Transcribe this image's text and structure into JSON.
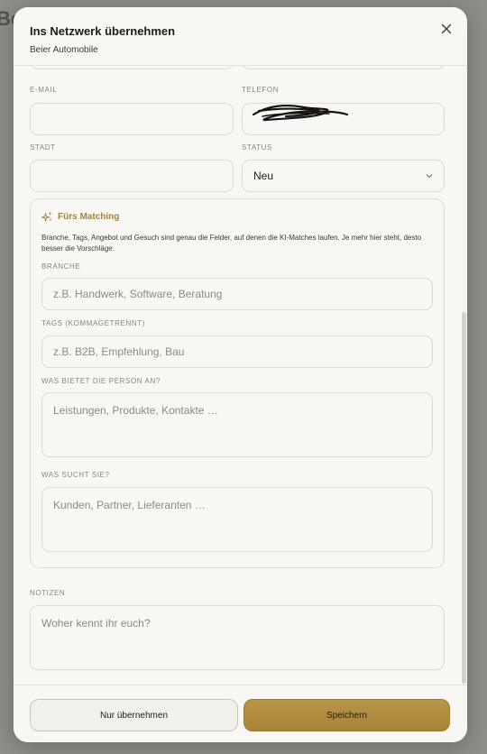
{
  "backdrop": {
    "peek_text": "Be"
  },
  "modal": {
    "title": "Ins Netzwerk übernehmen",
    "subtitle": "Beier Automobile"
  },
  "fields": {
    "email": {
      "label": "E-MAIL",
      "value": "",
      "placeholder": ""
    },
    "telefon": {
      "label": "TELEFON",
      "value": ""
    },
    "stadt": {
      "label": "STADT",
      "value": "",
      "placeholder": ""
    },
    "status": {
      "label": "STATUS",
      "value": "Neu"
    }
  },
  "matching": {
    "title": "Fürs Matching",
    "description": "Branche, Tags, Angebot und Gesuch sind genau die Felder, auf denen die KI-Matches laufen. Je mehr hier steht, desto besser die Vorschläge.",
    "branche": {
      "label": "BRANCHE",
      "placeholder": "z.B. Handwerk, Software, Beratung"
    },
    "tags": {
      "label": "TAGS (KOMMAGETRENNT)",
      "placeholder": "z.B. B2B, Empfehlung, Bau"
    },
    "bietet": {
      "label": "WAS BIETET DIE PERSON AN?",
      "placeholder": "Leistungen, Produkte, Kontakte …"
    },
    "sucht": {
      "label": "WAS SUCHT SIE?",
      "placeholder": "Kunden, Partner, Lieferanten …"
    }
  },
  "notizen": {
    "label": "NOTIZEN",
    "placeholder": "Woher kennt ihr euch?"
  },
  "footer": {
    "secondary_label": "Nur übernehmen",
    "primary_label": "Speichern"
  },
  "colors": {
    "accent": "#a8843a",
    "background": "#f9f7f3",
    "border": "#dedad2"
  }
}
